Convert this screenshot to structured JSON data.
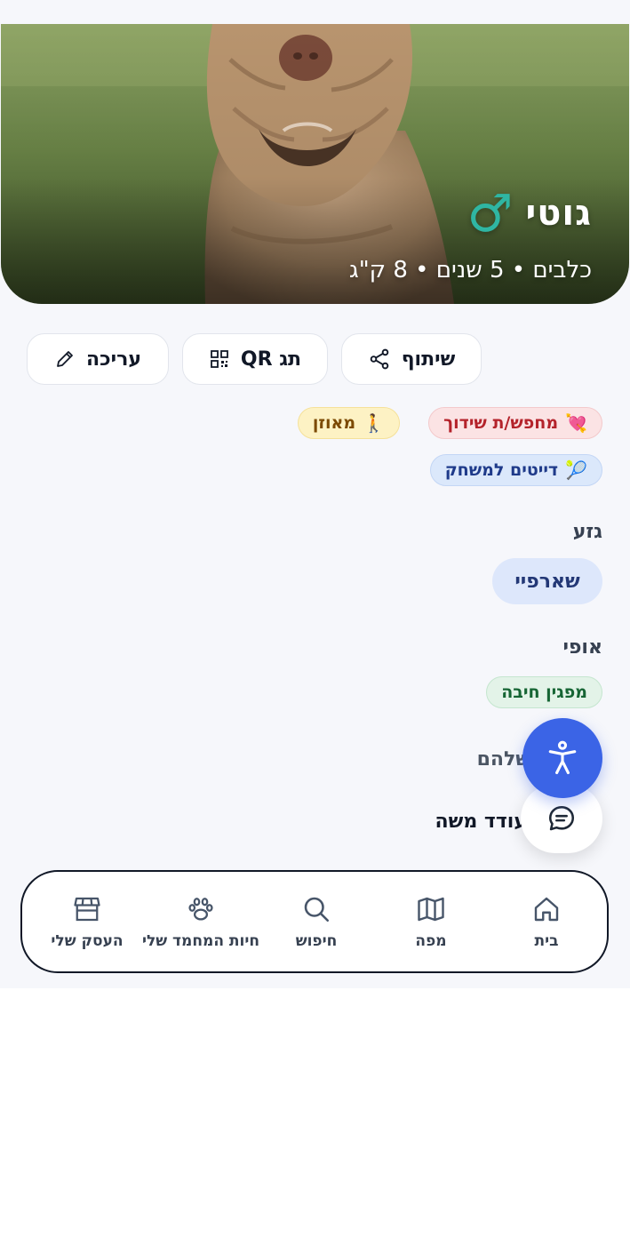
{
  "hero": {
    "name": "גוטי",
    "gender_symbol": "♂",
    "subtitle": "כלבים • 5 שנים • 8 ק\"ג"
  },
  "actions": {
    "share_label": "שיתוף",
    "qr_label": "תג QR",
    "edit_label": "עריכה"
  },
  "tags": [
    {
      "emoji": "💘",
      "label": "מחפש/ת שידוך",
      "bg": "#fbe3e4",
      "color": "#b4232b"
    },
    {
      "emoji": "🚶",
      "label": "מאוזן",
      "bg": "#fdf2c4",
      "color": "#7c4a03"
    },
    {
      "emoji": "🎾",
      "label": "דייטים למשחק",
      "bg": "#dbe8fb",
      "color": "#1e3a8a"
    }
  ],
  "breed": {
    "title": "גזע",
    "value": "שארפיי"
  },
  "temperament": {
    "title": "אופי",
    "value": "מפגין חיבה"
  },
  "partial": {
    "line1": "שלהם",
    "line2": "עודד משה"
  },
  "nav": {
    "items": [
      {
        "label": "בית",
        "icon": "home-icon"
      },
      {
        "label": "מפה",
        "icon": "map-icon"
      },
      {
        "label": "חיפוש",
        "icon": "search-icon"
      },
      {
        "label": "חיות המחמד שלי",
        "icon": "paw-icon"
      },
      {
        "label": "העסק שלי",
        "icon": "store-icon"
      }
    ]
  },
  "colors": {
    "accent": "#3b64e6",
    "male": "#2fb6a3"
  }
}
